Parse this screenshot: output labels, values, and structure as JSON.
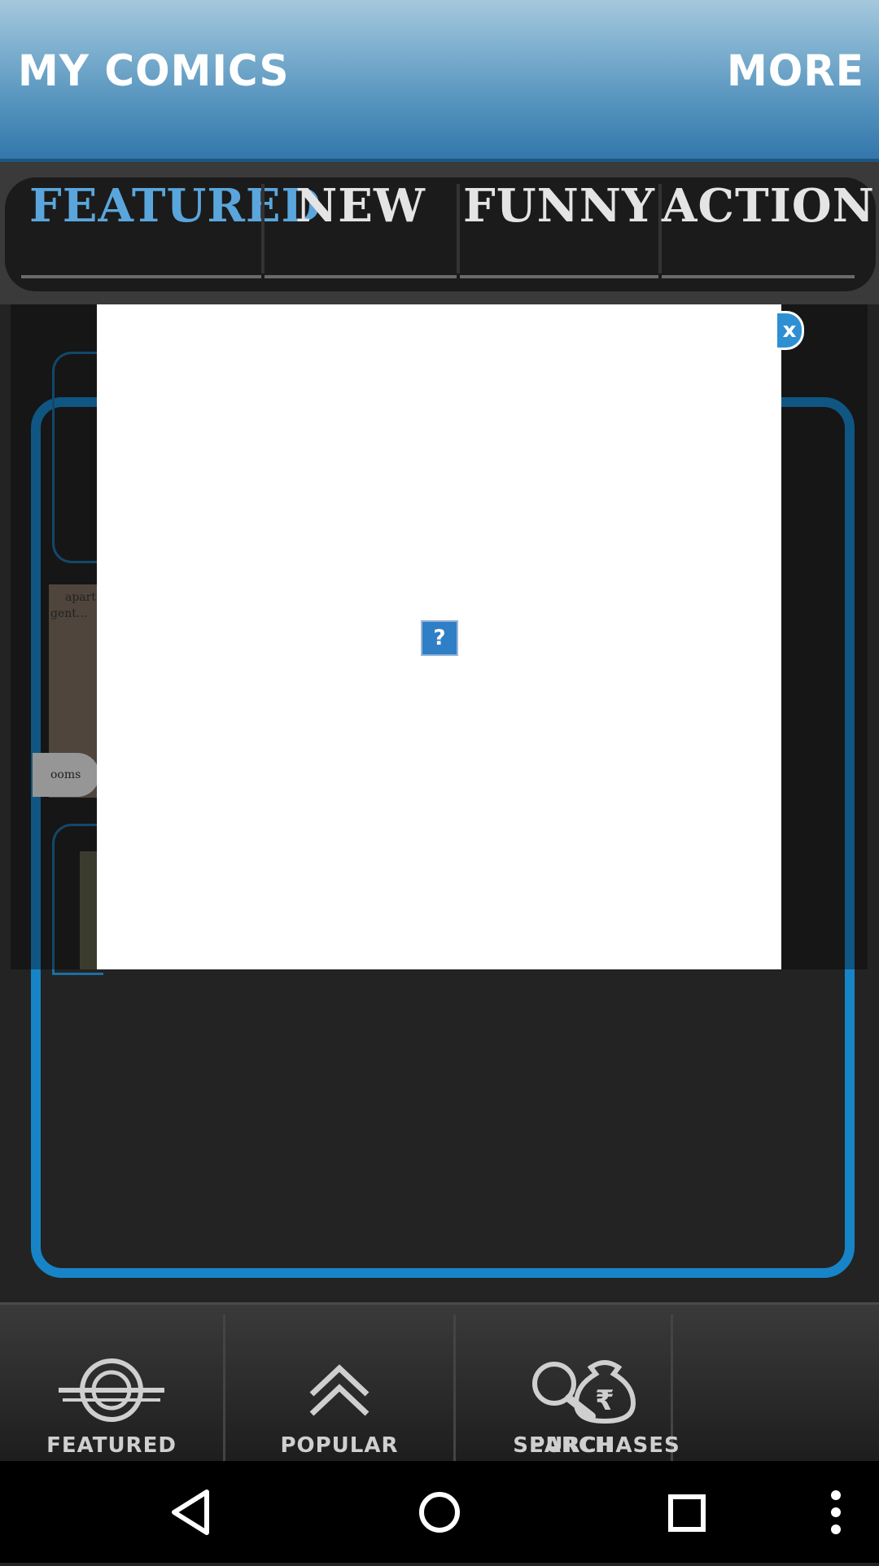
{
  "header": {
    "title": "MY COMICS",
    "more_label": "MORE"
  },
  "tabs": [
    {
      "label": "Featured",
      "selected": true
    },
    {
      "label": "New",
      "selected": false
    },
    {
      "label": "Funny",
      "selected": false
    },
    {
      "label": "Action",
      "selected": false
    }
  ],
  "background_snippets": {
    "line1": "apart",
    "line2": "gent...",
    "line3": "ooms"
  },
  "popup": {
    "close_label": "x",
    "broken_image_label": "?"
  },
  "bottom_nav": [
    {
      "label": "FEATURED",
      "icon": "featured-icon"
    },
    {
      "label": "POPULAR",
      "icon": "popular-icon"
    },
    {
      "label": "SEARCH",
      "icon": "search-icon"
    },
    {
      "label": "PURCHASES",
      "icon": "purchases-icon"
    }
  ],
  "system_bar": {
    "buttons": [
      "back-icon",
      "home-icon",
      "recents-icon",
      "menu-icon"
    ]
  },
  "colors": {
    "accent": "#1784c8",
    "header_top": "#a5c8dd",
    "header_bottom": "#3377ab",
    "selected_tab": "#5aa6dc"
  }
}
